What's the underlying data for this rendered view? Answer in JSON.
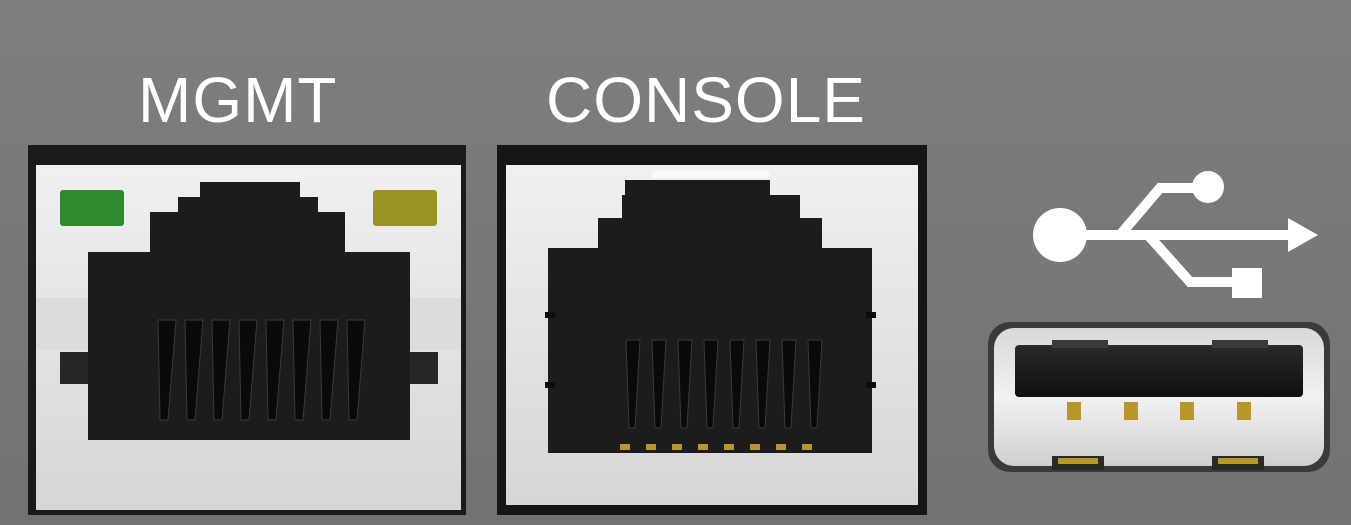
{
  "ports": {
    "mgmt": {
      "label": "MGMT",
      "type": "rj45-ethernet",
      "led_left_color": "#2f8a2f",
      "led_right_color": "#9a9322"
    },
    "console": {
      "label": "CONSOLE",
      "type": "rj45-serial"
    },
    "usb": {
      "type": "usb-type-a",
      "icon": "usb-icon"
    }
  },
  "colors": {
    "faceplate": "#7a7a7a",
    "port_housing": "#e4e4e4",
    "port_cavity": "#1c1c1c",
    "contact_gold": "#b8962a"
  }
}
